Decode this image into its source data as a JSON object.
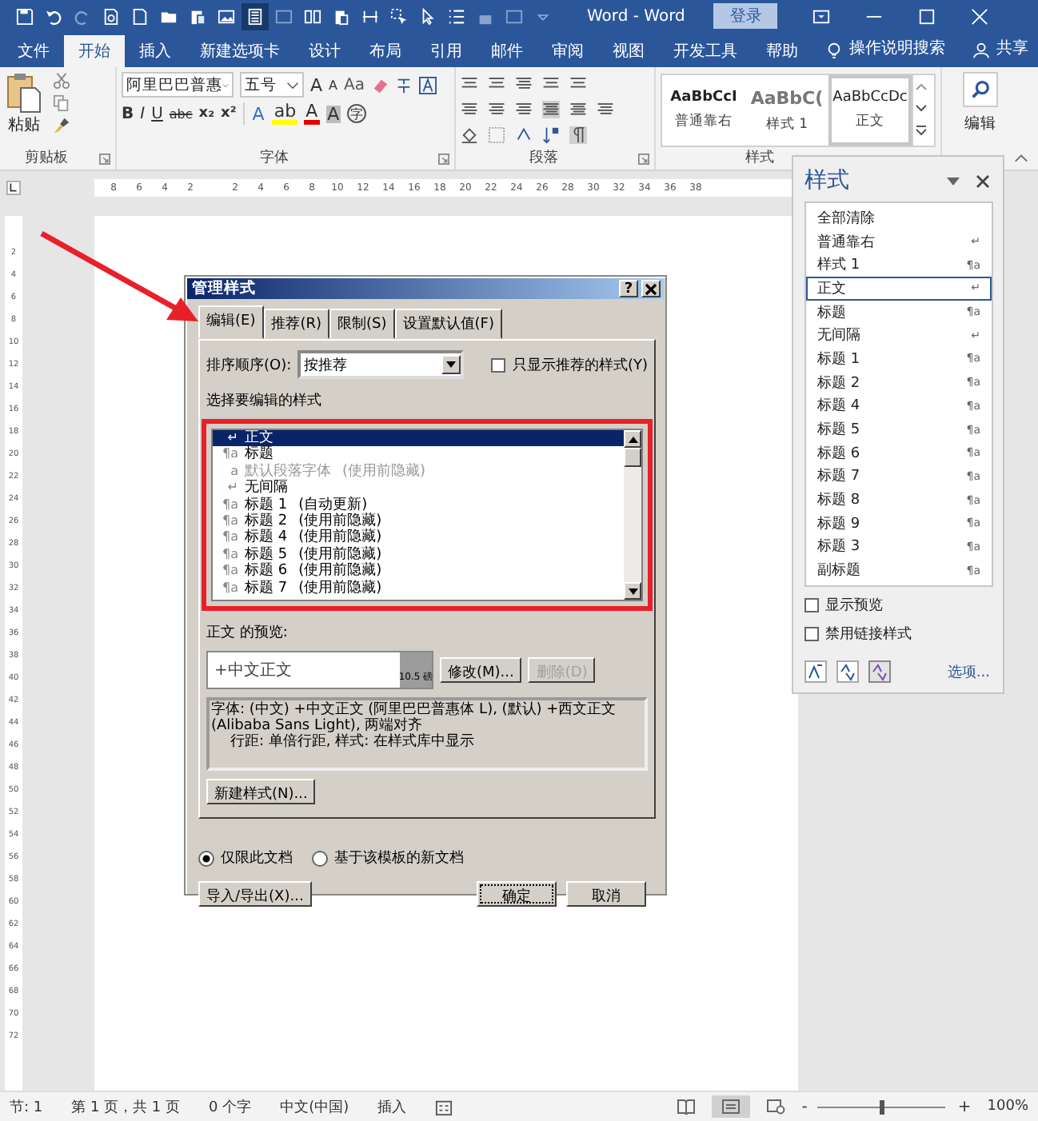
{
  "window": {
    "title": "Word - Word",
    "login": "登录"
  },
  "tabs": [
    {
      "label": "文件",
      "selected": false
    },
    {
      "label": "开始",
      "selected": true
    },
    {
      "label": "插入",
      "selected": false
    },
    {
      "label": "新建选项卡",
      "selected": false
    },
    {
      "label": "设计",
      "selected": false
    },
    {
      "label": "布局",
      "selected": false
    },
    {
      "label": "引用",
      "selected": false
    },
    {
      "label": "邮件",
      "selected": false
    },
    {
      "label": "审阅",
      "selected": false
    },
    {
      "label": "视图",
      "selected": false
    },
    {
      "label": "开发工具",
      "selected": false
    },
    {
      "label": "帮助",
      "selected": false
    }
  ],
  "tell_me": "操作说明搜索",
  "share": "共享",
  "ribbon": {
    "paste": "粘贴",
    "font_name": "阿里巴巴普惠",
    "font_size": "五号",
    "grow": "A",
    "shrink": "A",
    "change_case": "Aa",
    "format_buttons": [
      "B",
      "I",
      "U",
      "abc",
      "x₂",
      "x²"
    ],
    "font_tools": [
      {
        "glyph": "A",
        "kind": "effects"
      },
      {
        "glyph": "ab",
        "kind": "highlight"
      },
      {
        "glyph": "A",
        "kind": "color"
      },
      {
        "glyph": "A",
        "kind": "shading"
      },
      {
        "glyph": "字",
        "kind": "enclose"
      }
    ],
    "gallery": [
      {
        "sample": "AaBbCcI",
        "name": "普通靠右",
        "kind": "bold",
        "selected": false
      },
      {
        "sample": "AaBbC(",
        "name": "样式 1",
        "kind": "heading",
        "selected": false
      },
      {
        "sample": "AaBbCcDc",
        "name": "正文",
        "kind": "normal",
        "selected": true
      }
    ],
    "editing": "编辑",
    "groups": [
      "剪贴板",
      "字体",
      "段落",
      "样式"
    ]
  },
  "ruler": {
    "horizontal": [
      "8",
      "6",
      "4",
      "2",
      "2",
      "4",
      "6",
      "8",
      "10",
      "12",
      "14",
      "16",
      "18",
      "20",
      "22",
      "24",
      "26",
      "28",
      "30",
      "32",
      "34",
      "36",
      "38"
    ],
    "vertical": [
      "2",
      "4",
      "6",
      "8",
      "10",
      "12",
      "14",
      "16",
      "18",
      "20",
      "22",
      "24",
      "26",
      "28",
      "30",
      "32",
      "34",
      "36",
      "38",
      "40",
      "42",
      "44",
      "46",
      "48",
      "50",
      "52",
      "54",
      "56",
      "58",
      "60",
      "62",
      "64",
      "66",
      "68",
      "70",
      "72"
    ]
  },
  "dialog": {
    "title": "管理样式",
    "help": "?",
    "tabs": [
      {
        "label": "编辑(E)",
        "selected": true
      },
      {
        "label": "推荐(R)",
        "selected": false
      },
      {
        "label": "限制(S)",
        "selected": false
      },
      {
        "label": "设置默认值(F)",
        "selected": false
      }
    ],
    "sort_label": "排序顺序(O):",
    "sort_value": "按推荐",
    "only_recommended": {
      "label": "只显示推荐的样式(Y)",
      "checked": false
    },
    "list_label": "选择要编辑的样式",
    "styles": [
      {
        "mark": "↵",
        "name": "正文",
        "selected": true,
        "dimmed": false
      },
      {
        "mark": "¶a",
        "name": "标题",
        "selected": false,
        "dimmed": false
      },
      {
        "mark": "a",
        "name": "默认段落字体",
        "note": "(使用前隐藏)",
        "selected": false,
        "dimmed": true
      },
      {
        "mark": "↵",
        "name": "无间隔",
        "selected": false,
        "dimmed": false
      },
      {
        "mark": "¶a",
        "name": "标题 1",
        "note": "(自动更新)",
        "selected": false,
        "dimmed": false
      },
      {
        "mark": "¶a",
        "name": "标题 2",
        "note": "(使用前隐藏)",
        "selected": false,
        "dimmed": false
      },
      {
        "mark": "¶a",
        "name": "标题 4",
        "note": "(使用前隐藏)",
        "selected": false,
        "dimmed": false
      },
      {
        "mark": "¶a",
        "name": "标题 5",
        "note": "(使用前隐藏)",
        "selected": false,
        "dimmed": false
      },
      {
        "mark": "¶a",
        "name": "标题 6",
        "note": "(使用前隐藏)",
        "selected": false,
        "dimmed": false
      },
      {
        "mark": "¶a",
        "name": "标题 7",
        "note": "(使用前隐藏)",
        "selected": false,
        "dimmed": false
      }
    ],
    "preview_label": "正文 的预览:",
    "preview_text": "+中文正文",
    "preview_size": "10.5 磅",
    "modify": {
      "label": "修改(M)...",
      "disabled": false
    },
    "delete": {
      "label": "删除(D)",
      "disabled": true
    },
    "description": [
      "字体: (中文) +中文正文 (阿里巴巴普惠体 L), (默认) +西文正文 (Alibaba Sans Light), 两端对齐",
      "行距: 单倍行距, 样式: 在样式库中显示"
    ],
    "new_style": "新建样式(N)...",
    "radios": [
      {
        "label": "仅限此文档",
        "selected": true
      },
      {
        "label": "基于该模板的新文档",
        "selected": false
      }
    ],
    "import_export": "导入/导出(X)...",
    "ok": "确定",
    "cancel": "取消"
  },
  "styles_pane": {
    "title": "样式",
    "items": [
      {
        "name": "全部清除",
        "selected": false
      },
      {
        "name": "普通靠右",
        "mark": "↵",
        "selected": false
      },
      {
        "name": "样式 1",
        "mark": "¶a",
        "selected": false
      },
      {
        "name": "正文",
        "mark": "↵",
        "selected": true
      },
      {
        "name": "标题",
        "mark": "¶a",
        "selected": false
      },
      {
        "name": "无间隔",
        "mark": "↵",
        "selected": false
      },
      {
        "name": "标题 1",
        "mark": "¶a",
        "selected": false
      },
      {
        "name": "标题 2",
        "mark": "¶a",
        "selected": false
      },
      {
        "name": "标题 4",
        "mark": "¶a",
        "selected": false
      },
      {
        "name": "标题 5",
        "mark": "¶a",
        "selected": false
      },
      {
        "name": "标题 6",
        "mark": "¶a",
        "selected": false
      },
      {
        "name": "标题 7",
        "mark": "¶a",
        "selected": false
      },
      {
        "name": "标题 8",
        "mark": "¶a",
        "selected": false
      },
      {
        "name": "标题 9",
        "mark": "¶a",
        "selected": false
      },
      {
        "name": "标题 3",
        "mark": "¶a",
        "selected": false
      },
      {
        "name": "副标题",
        "mark": "¶a",
        "selected": false
      }
    ],
    "checkboxes": [
      {
        "label": "显示预览",
        "checked": false
      },
      {
        "label": "禁用链接样式",
        "checked": false
      }
    ],
    "options": "选项..."
  },
  "status_bar": {
    "items": [
      "节: 1",
      "第 1 页，共 1 页",
      "0 个字",
      "中文(中国)",
      "插入"
    ],
    "views": [
      {
        "kind": "read",
        "selected": false
      },
      {
        "kind": "print",
        "selected": true
      },
      {
        "kind": "web",
        "selected": false
      }
    ],
    "zoom_out": "-",
    "zoom_in": "+",
    "zoom": {
      "level": 0.5
    },
    "zoom_text": "100%"
  }
}
